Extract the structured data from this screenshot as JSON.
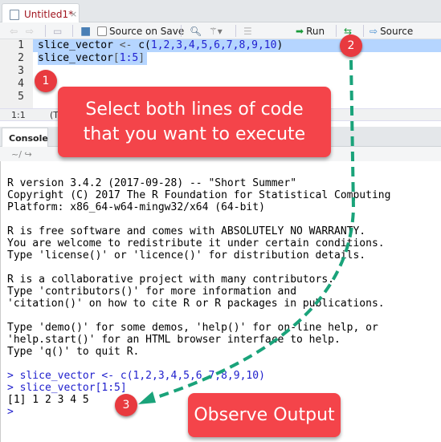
{
  "editor_tab": {
    "title": "Untitled1*",
    "close": "×"
  },
  "toolbar": {
    "source_on_save": "Source on Save",
    "run": "Run",
    "source": "Source"
  },
  "editor": {
    "line_numbers": [
      "1",
      "2",
      "3",
      "4",
      "5"
    ],
    "line1": {
      "name": "slice_vector",
      "op": "<-",
      "fn": "c(",
      "nums": "1,2,3,4,5,6,7,8,9,10",
      "close": ")"
    },
    "line2": {
      "name": "slice_vector",
      "open": "[",
      "range": "1:5",
      "close": "]"
    }
  },
  "status": {
    "position": "1:1",
    "scope": "(T"
  },
  "console_tab": {
    "label": "Console",
    "path": "~/"
  },
  "console": {
    "lines": [
      "R version 3.4.2 (2017-09-28) -- \"Short Summer\"",
      "Copyright (C) 2017 The R Foundation for Statistical Computing",
      "Platform: x86_64-w64-mingw32/x64 (64-bit)",
      "",
      "R is free software and comes with ABSOLUTELY NO WARRANTY.",
      "You are welcome to redistribute it under certain conditions.",
      "Type 'license()' or 'licence()' for distribution details.",
      "",
      "R is a collaborative project with many contributors.",
      "Type 'contributors()' for more information and",
      "'citation()' on how to cite R or R packages in publications.",
      "",
      "Type 'demo()' for some demos, 'help()' for on-line help, or",
      "'help.start()' for an HTML browser interface to help.",
      "Type 'q()' to quit R.",
      ""
    ],
    "cmd1": "> slice_vector <- c(1,2,3,4,5,6,7,8,9,10)",
    "cmd2": "> slice_vector[1:5]",
    "output": "[1] 1 2 3 4 5",
    "prompt": ">"
  },
  "annotations": {
    "step1": "1",
    "step2": "2",
    "step3": "3",
    "callout1": "Select both lines of code that you want to execute",
    "callout2": "Observe Output",
    "arrow_color": "#1aa37a",
    "callout_color": "#f4444a"
  }
}
